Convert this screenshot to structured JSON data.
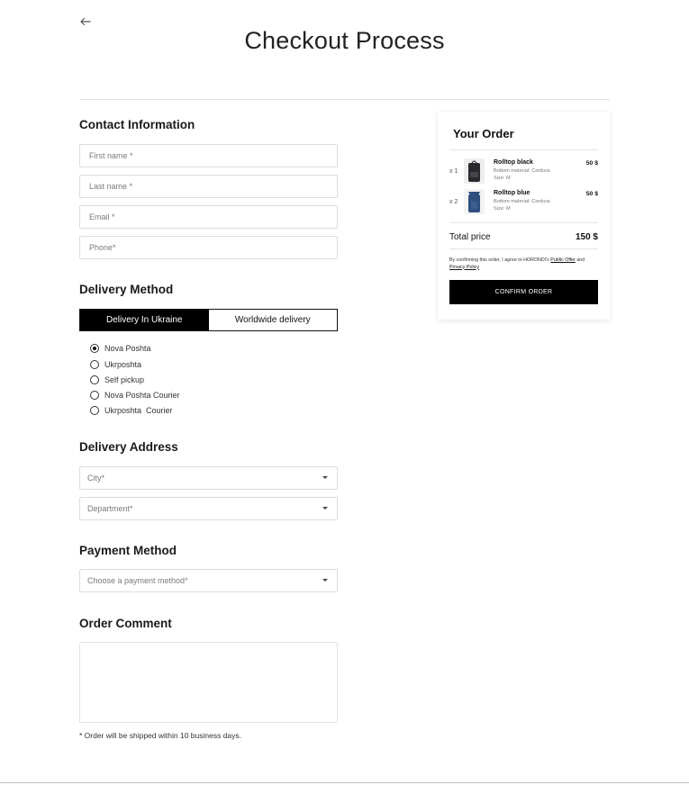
{
  "header": {
    "title": "Checkout Process",
    "back_icon": "arrow-left-icon"
  },
  "contact": {
    "title": "Contact Information",
    "fields": [
      {
        "placeholder": "First name *",
        "value": ""
      },
      {
        "placeholder": "Last name *",
        "value": ""
      },
      {
        "placeholder": "Email *",
        "value": ""
      },
      {
        "placeholder": "Phone*",
        "value": ""
      }
    ]
  },
  "delivery": {
    "title": "Delivery Method",
    "tabs": [
      {
        "label": "Delivery In Ukraine",
        "active": true
      },
      {
        "label": "Worldwide delivery",
        "active": false
      }
    ],
    "options": [
      {
        "label": "Nova Poshta",
        "selected": true
      },
      {
        "label": "Ukrposhta",
        "selected": false
      },
      {
        "label": "Self pickup",
        "selected": false
      },
      {
        "label": "Nova Poshta Courier",
        "selected": false
      },
      {
        "label": "Ukrposhta  Courier",
        "selected": false
      }
    ]
  },
  "address": {
    "title": "Delivery Address",
    "city": {
      "placeholder": "City*"
    },
    "department": {
      "placeholder": "Department*"
    }
  },
  "payment": {
    "title": "Payment Method",
    "select": {
      "placeholder": "Choose a payment method*"
    }
  },
  "comment": {
    "title": "Order Comment",
    "note": "* Order will be shipped within 10 business days."
  },
  "order": {
    "title": "Your Order",
    "items": [
      {
        "qty": "x 1",
        "name": "Rolltop black",
        "material": "Bottom material: Cordura",
        "size": "Size: M",
        "price": "50 $",
        "color": "#2a2a2e"
      },
      {
        "qty": "x 2",
        "name": "Rolltop blue",
        "material": "Bottom material: Cordura",
        "size": "Size: M",
        "price": "50 $",
        "color": "#2f4f7f"
      }
    ],
    "total_label": "Total price",
    "total_value": "150 $",
    "terms_prefix": "By confirming this order, I agree to HORONDI's ",
    "terms_link1": "Public Offer",
    "terms_mid": " and ",
    "terms_link2": "Privacy Policy",
    "confirm_label": "CONFIRM ORDER"
  }
}
